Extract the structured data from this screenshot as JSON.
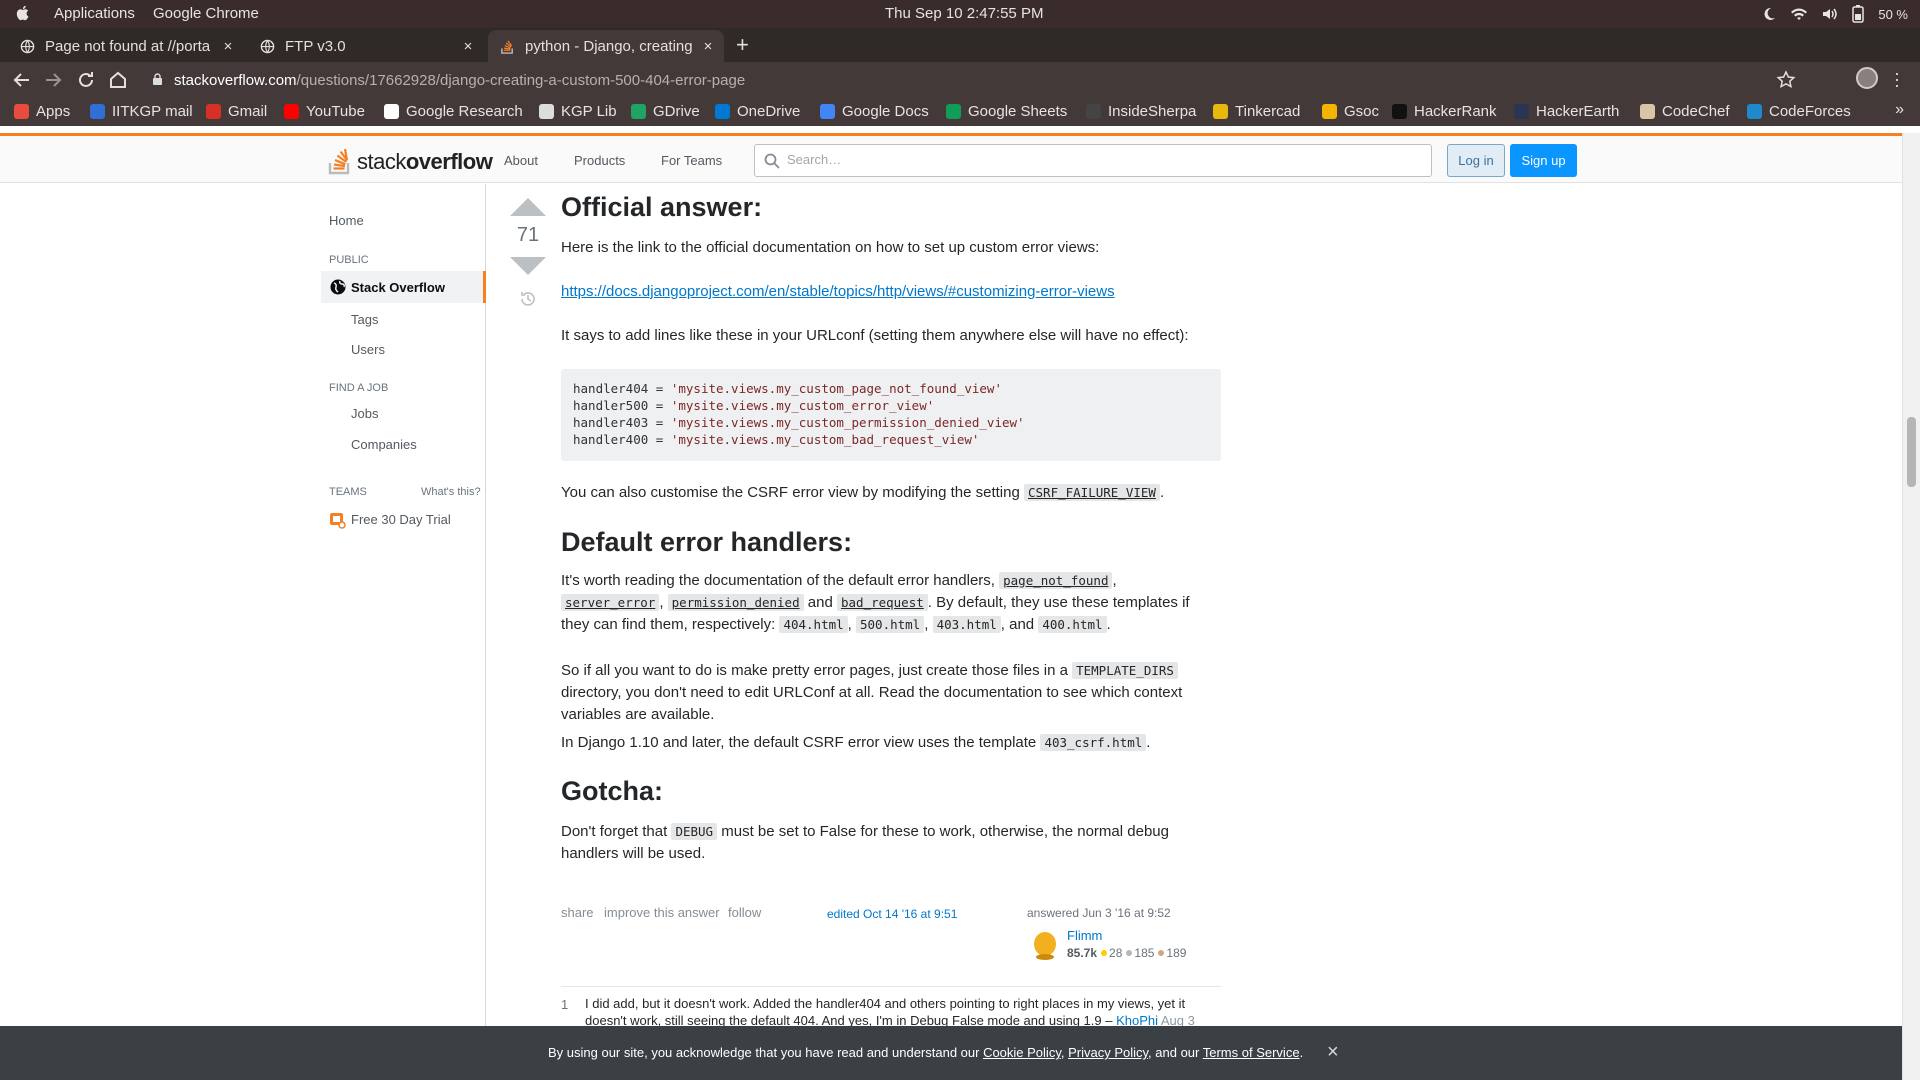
{
  "os": {
    "menu_applications": "Applications",
    "menu_app": "Google Chrome",
    "clock": "Thu Sep 10   2:47:55 PM",
    "battery": "50 %"
  },
  "tabs": [
    {
      "label": "Page not found at //porta",
      "close": "×"
    },
    {
      "label": "FTP v3.0",
      "close": "×"
    },
    {
      "label": "python - Django, creating",
      "close": "×"
    }
  ],
  "newtab": "+",
  "omnibox": {
    "host": "stackoverflow.com",
    "path": "/questions/17662928/django-creating-a-custom-500-404-error-page"
  },
  "bookmarks": [
    {
      "label": "Apps",
      "color": "#e74c3c"
    },
    {
      "label": "IITKGP mail",
      "color": "#2f6fd6"
    },
    {
      "label": "Gmail",
      "color": "#d93025"
    },
    {
      "label": "YouTube",
      "color": "#ff0000"
    },
    {
      "label": "Google Research",
      "color": "#ffffff"
    },
    {
      "label": "KGP Lib",
      "color": "#dddddd"
    },
    {
      "label": "GDrive",
      "color": "#1fa463"
    },
    {
      "label": "OneDrive",
      "color": "#0078d4"
    },
    {
      "label": "Google Docs",
      "color": "#4285f4"
    },
    {
      "label": "Google Sheets",
      "color": "#0f9d58"
    },
    {
      "label": "InsideSherpa",
      "color": "#444444"
    },
    {
      "label": "Tinkercad",
      "color": "#e8b80c"
    },
    {
      "label": "Gsoc",
      "color": "#f4b400"
    },
    {
      "label": "HackerRank",
      "color": "#111111"
    },
    {
      "label": "HackerEarth",
      "color": "#2c3454"
    },
    {
      "label": "CodeChef",
      "color": "#d9c4a5"
    },
    {
      "label": "CodeForces",
      "color": "#1f8acb"
    }
  ],
  "bookmarks_more": "»",
  "so": {
    "logo_plain": "stack",
    "logo_bold": "overflow",
    "nav_about": "About",
    "nav_products": "Products",
    "nav_teams": "For Teams",
    "search_placeholder": "Search…",
    "login": "Log in",
    "signup": "Sign up",
    "accent": "#f48024"
  },
  "leftnav": {
    "home": "Home",
    "public": "PUBLIC",
    "stack_overflow": "Stack Overflow",
    "tags": "Tags",
    "users": "Users",
    "find_a_job": "FIND A JOB",
    "jobs": "Jobs",
    "companies": "Companies",
    "teams": "TEAMS",
    "whats_this": "What's this?",
    "trial": "Free 30 Day Trial"
  },
  "post": {
    "votes": "71",
    "h_official": "Official answer:",
    "p_link_intro": "Here is the link to the official documentation on how to set up custom error views:",
    "doc_link": "https://docs.djangoproject.com/en/stable/topics/http/views/#customizing-error-views",
    "p_urlconf": "It says to add lines like these in your URLconf (setting them anywhere else will have no effect):",
    "code_lines": [
      {
        "lhs": "handler404 = ",
        "rhs": "'mysite.views.my_custom_page_not_found_view'"
      },
      {
        "lhs": "handler500 = ",
        "rhs": "'mysite.views.my_custom_error_view'"
      },
      {
        "lhs": "handler403 = ",
        "rhs": "'mysite.views.my_custom_permission_denied_view'"
      },
      {
        "lhs": "handler400 = ",
        "rhs": "'mysite.views.my_custom_bad_request_view'"
      }
    ],
    "p_csrf_a": "You can also customise the CSRF error view by modifying the setting ",
    "csrf_setting": "CSRF_FAILURE_VIEW",
    "p_csrf_b": ".",
    "h_default": "Default error handlers:",
    "p_def_a": "It's worth reading the documentation of the default error handlers, ",
    "page_not_found": "page_not_found",
    "comma": ",",
    "server_error": "server_error",
    "permission_denied": "permission_denied",
    "and_word": "and",
    "bad_request": "bad_request",
    "p_def_b": ". By default, they use these templates if they can find them, respectively: ",
    "t404": "404.html",
    "t500": "500.html",
    "t403": "403.html",
    "and_comma": ", and",
    "t400": "400.html",
    "period": ".",
    "p_pretty_a": "So if all you want to do is make pretty error pages, just create those files in a ",
    "template_dirs": "TEMPLATE_DIRS",
    "p_pretty_b": " directory, you don't need to edit URLConf at all. Read the documentation to see which context variables are available.",
    "p_110_a": "In Django 1.10 and later, the default CSRF error view uses the template ",
    "csrf_template": "403_csrf.html",
    "h_gotcha": "Gotcha:",
    "p_gotcha_a": "Don't forget that ",
    "debug": "DEBUG",
    "p_gotcha_b": " must be set to False for these to work, otherwise, the normal debug handlers will be used.",
    "share": "share",
    "improve": "improve this answer",
    "follow": "follow",
    "edited": "edited Oct 14 '16 at 9:51",
    "answered": "answered Jun 3 '16 at 9:52",
    "user": "Flimm",
    "rep": "85.7k",
    "gold": "28",
    "silver": "185",
    "bronze": "189"
  },
  "comment": {
    "score": "1",
    "text": "I did add, but it doesn't work. Added the handler404 and others pointing to right places in my views, yet it doesn't work, still seeing the default 404. And yes, I'm in Debug False mode and using 1.9 – ",
    "user": "KhoPhi",
    "date": "Aug 3"
  },
  "cookie": {
    "text_a": "By using our site, you acknowledge that you have read and understand our ",
    "cookie_policy": "Cookie Policy",
    "sep1": ", ",
    "privacy_policy": "Privacy Policy",
    "text_b": ", and our ",
    "terms": "Terms of Service",
    "text_c": ".",
    "close": "×"
  }
}
